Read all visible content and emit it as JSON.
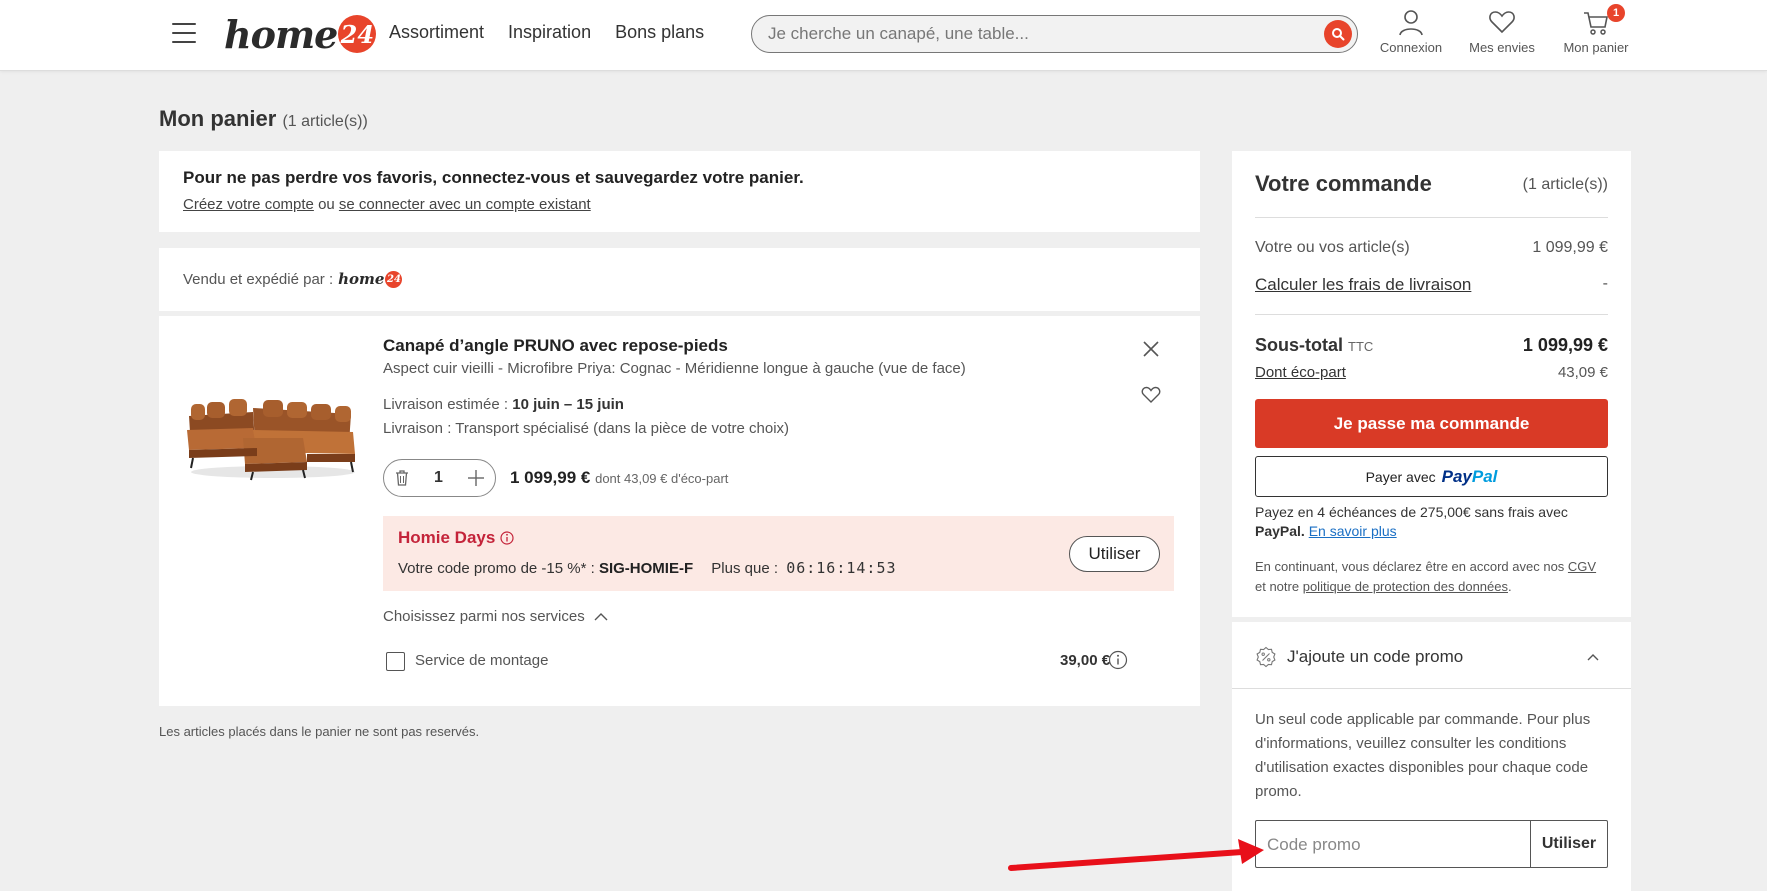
{
  "header": {
    "logo_text": "home",
    "logo_badge": "24",
    "nav": [
      "Assortiment",
      "Inspiration",
      "Bons plans"
    ],
    "search_placeholder": "Je cherche un canapé, une table...",
    "account_label": "Connexion",
    "wishlist_label": "Mes envies",
    "cart_label": "Mon panier",
    "cart_count": "1",
    "brand_color": "#e8442b"
  },
  "cart": {
    "title": "Mon panier",
    "count": "(1 article(s))"
  },
  "login_banner": {
    "headline": "Pour ne pas perdre vos favoris, connectez-vous et sauvegardez votre panier.",
    "create_account": "Créez votre compte",
    "or": "ou",
    "login_existing": "se connecter avec un compte existant"
  },
  "seller": {
    "label": "Vendu et expédié par :",
    "logo_text": "home",
    "logo_badge": "24"
  },
  "product": {
    "title": "Canapé d’angle PRUNO avec repose-pieds",
    "variant": "Aspect cuir vieilli - Microfibre Priya: Cognac - Méridienne longue à gauche (vue de face)",
    "delivery_label": "Livraison estimée :",
    "delivery_dates": "10 juin – 15 juin",
    "transport": "Livraison : Transport spécialisé (dans la pièce de votre choix)",
    "quantity": "1",
    "price": "1 099,99 €",
    "eco_part": "dont 43,09 € d'éco-part"
  },
  "promo_banner": {
    "title": "Homie Days",
    "text": "Votre code promo de -15 %* :",
    "code": "SIG-HOMIE-F",
    "countdown_label": "Plus que :",
    "countdown": "06:16:14:53",
    "button": "Utiliser",
    "bg_color": "#fce9e4",
    "title_color": "#c4243a"
  },
  "services": {
    "toggle_label": "Choisissez parmi nos services",
    "items": [
      {
        "label": "Service de montage",
        "price": "39,00 €",
        "checked": false
      }
    ]
  },
  "footnote": "Les articles placés dans le panier ne sont pas reservés.",
  "order": {
    "title": "Votre commande",
    "count": "(1 article(s))",
    "items_label": "Votre ou vos article(s)",
    "items_value": "1 099,99 €",
    "shipping_label": "Calculer les frais de livraison",
    "shipping_value": "-",
    "subtotal_label": "Sous-total",
    "subtotal_ttc": "TTC",
    "subtotal_value": "1 099,99 €",
    "eco_label": "Dont éco-part",
    "eco_value": "43,09 €",
    "checkout_button": "Je passe ma commande",
    "checkout_color": "#d93a26",
    "paypal_prefix": "Payer avec",
    "paypal_logo_a": "Pay",
    "paypal_logo_b": "Pal",
    "paypal_info_1": "Payez en 4 échéances de 275,00€ sans frais avec",
    "paypal_info_brand": "PayPal.",
    "paypal_info_link": "En savoir plus",
    "legal_1": "En continuant, vous déclarez être en accord avec nos",
    "legal_cgv": "CGV",
    "legal_2": "et notre",
    "legal_privacy": "politique de protection des données",
    "legal_end": "."
  },
  "promo_code": {
    "header": "J'ajoute un code promo",
    "info": "Un seul code applicable par commande. Pour plus d'informations, veuillez consulter les conditions d'utilisation exactes disponibles pour chaque code promo.",
    "placeholder": "Code promo",
    "button": "Utiliser"
  }
}
